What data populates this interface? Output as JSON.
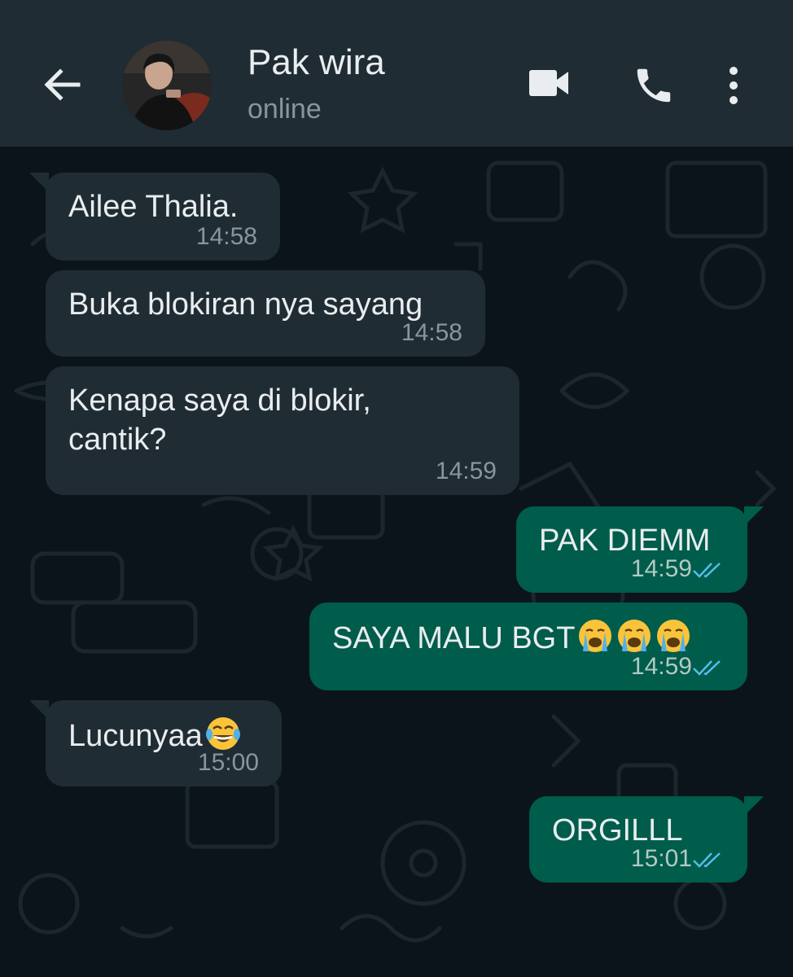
{
  "header": {
    "contact_name": "Pak wira",
    "status": "online",
    "icons": [
      "back-arrow-icon",
      "video-call-icon",
      "voice-call-icon",
      "more-options-icon"
    ]
  },
  "messages": [
    {
      "direction": "in",
      "text": "Ailee Thalia.",
      "time": "14:58"
    },
    {
      "direction": "in",
      "text": "Buka blokiran nya sayang",
      "time": "14:58"
    },
    {
      "direction": "in",
      "text_line1": "Kenapa saya di blokir,",
      "text_line2": "cantik?",
      "time": "14:59"
    },
    {
      "direction": "out",
      "text": "PAK DIEMM",
      "time": "14:59",
      "status": "read"
    },
    {
      "direction": "out",
      "text": "SAYA MALU BGT",
      "emoji": [
        "loudly-crying-face",
        "loudly-crying-face",
        "loudly-crying-face"
      ],
      "time": "14:59",
      "status": "read"
    },
    {
      "direction": "in",
      "text": "Lucunyaa",
      "emoji": [
        "face-with-tears-of-joy"
      ],
      "time": "15:00"
    },
    {
      "direction": "out",
      "text": "ORGILLL",
      "time": "15:01",
      "status": "read"
    }
  ],
  "colors": {
    "header_bg": "#1f2c34",
    "chat_bg": "#0b141a",
    "incoming_bubble": "#202c33",
    "outgoing_bubble": "#005c4b",
    "read_tick": "#53bdeb"
  }
}
